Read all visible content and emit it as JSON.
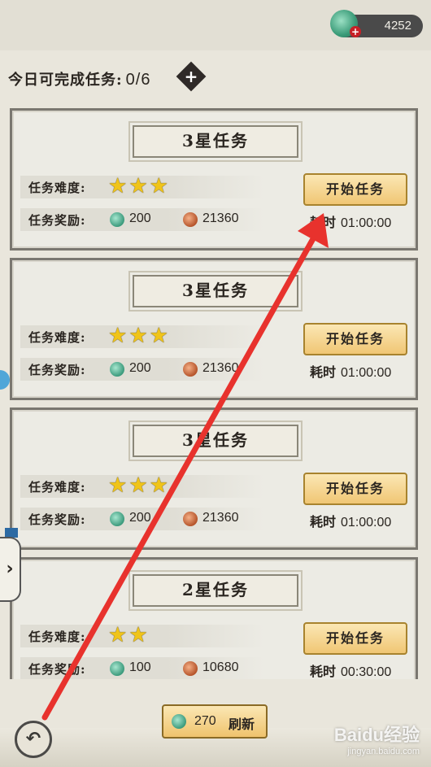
{
  "currency": {
    "amount": "4252",
    "plus": "+"
  },
  "daily": {
    "label": "今日可完成任务:",
    "count": "0/6",
    "plus": "+"
  },
  "labels": {
    "difficulty": "任务难度:",
    "reward": "任务奖励:",
    "duration": "耗时",
    "start": "开始任务"
  },
  "tasks": [
    {
      "title": "3星任务",
      "stars": 3,
      "jade": "200",
      "coin": "21360",
      "time": "01:00:00"
    },
    {
      "title": "3星任务",
      "stars": 3,
      "jade": "200",
      "coin": "21360",
      "time": "01:00:00"
    },
    {
      "title": "3星任务",
      "stars": 3,
      "jade": "200",
      "coin": "21360",
      "time": "01:00:00"
    },
    {
      "title": "2星任务",
      "stars": 2,
      "jade": "100",
      "coin": "10680",
      "time": "00:30:00"
    }
  ],
  "refresh": {
    "cost": "270",
    "label": "刷新"
  },
  "back": {
    "icon": "back-arrow-icon"
  },
  "watermark": {
    "brand": "Baidu经验",
    "url": "jingyan.baidu.com"
  },
  "colors": {
    "arrow": "#e8322d",
    "star": "#f0c419",
    "button": "#f0c674"
  }
}
